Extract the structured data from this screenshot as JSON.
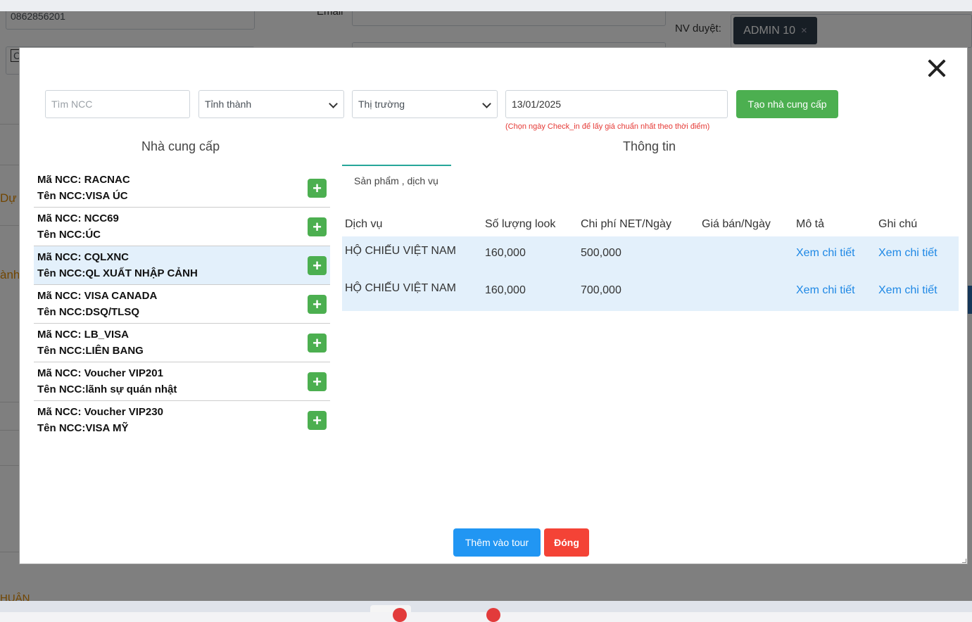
{
  "background": {
    "phone_value": "0862856201",
    "email_label": "Email",
    "approver_label": "NV duyệt:",
    "approver_tag": "ADMIN 10",
    "approver_tag_remove": "×",
    "partial_text_1": "Dự",
    "partial_text_2": "ành",
    "partial_text_3": "HUẬN",
    "partial_text_4": "C"
  },
  "modal": {
    "filters": {
      "search_placeholder": "Tìm NCC",
      "province_select": "Tỉnh thành",
      "market_select": "Thị trường",
      "date_value": "13/01/2025",
      "create_button": "Tạo nhà cung cấp",
      "date_hint": "(Chọn ngày Check_in để lấy giá chuẩn nhất theo thời điểm)"
    },
    "suppliers_title": "Nhà cung cấp",
    "info_title": "Thông tin",
    "suppliers": [
      {
        "code": "Mã NCC: RACNAC",
        "name": "Tên NCC:VISA ÚC",
        "add": "+"
      },
      {
        "code": "Mã NCC: NCC69",
        "name": "Tên NCC:ÚC",
        "add": "+"
      },
      {
        "code": "Mã NCC: CQLXNC",
        "name": "Tên NCC:QL XUẤT NHẬP CẢNH",
        "add": "+"
      },
      {
        "code": "Mã NCC: VISA CANADA",
        "name": "Tên NCC:DSQ/TLSQ",
        "add": "+"
      },
      {
        "code": "Mã NCC: LB_VISA",
        "name": "Tên NCC:LIÊN BANG",
        "add": "+"
      },
      {
        "code": "Mã NCC: Voucher VIP201",
        "name": "Tên NCC:lãnh sự quán nhật",
        "add": "+"
      },
      {
        "code": "Mã NCC: Voucher VIP230",
        "name": "Tên NCC:VISA MỸ",
        "add": "+"
      }
    ],
    "active_supplier_index": 2,
    "tab_label": "Sản phẩm , dịch vụ",
    "table": {
      "headers": [
        "Dịch vụ",
        "Số lượng look",
        "Chi phí NET/Ngày",
        "Giá bán/Ngày",
        "Mô tả",
        "Ghi chú"
      ],
      "rows": [
        [
          "HỘ CHIẾU VIỆT NAM",
          "160,000",
          "500,000",
          "",
          "Xem chi tiết",
          "Xem chi tiết"
        ],
        [
          "HỘ CHIẾU VIỆT NAM",
          "160,000",
          "700,000",
          "",
          "Xem chi tiết",
          "Xem chi tiết"
        ]
      ]
    },
    "add_to_tour_button": "Thêm vào tour",
    "close_button": "Đóng"
  },
  "colors": {
    "primary_blue": "#2196f3",
    "success_green": "#4caf50",
    "danger_red": "#f44336",
    "active_row": "#e3f0fb",
    "link": "#1e88e5"
  }
}
